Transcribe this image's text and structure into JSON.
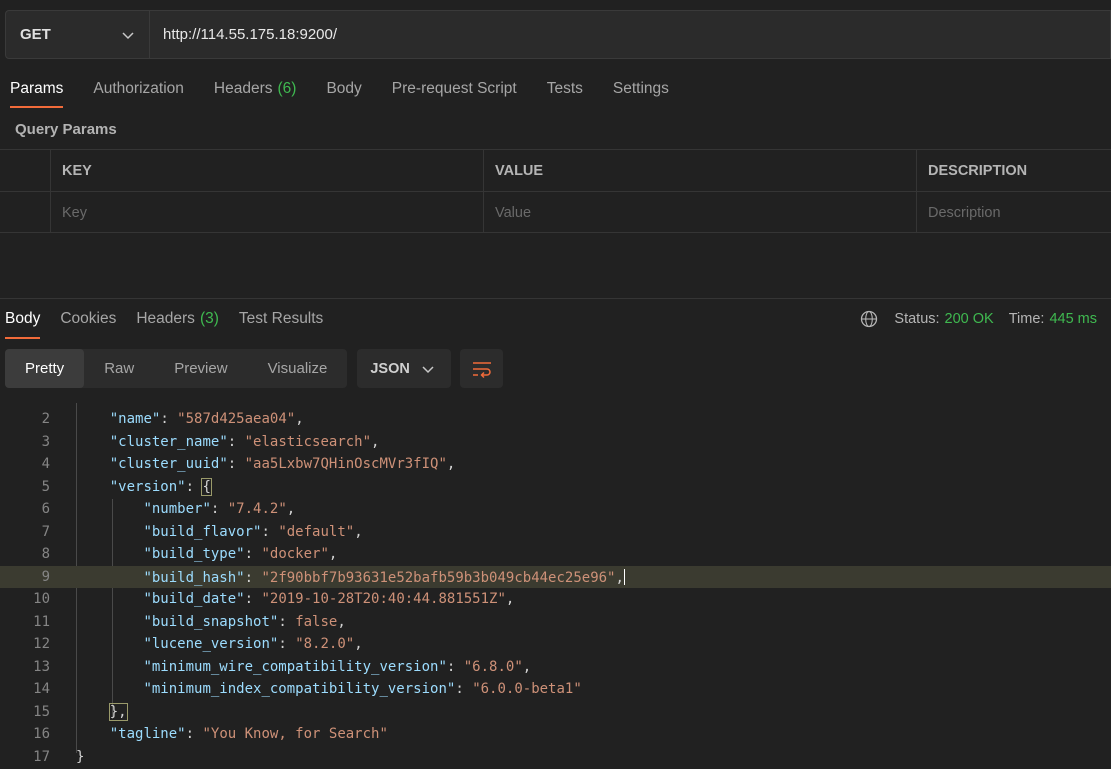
{
  "request": {
    "method": "GET",
    "url": "http://114.55.175.18:9200/"
  },
  "request_tabs": [
    {
      "label": "Params",
      "active": true
    },
    {
      "label": "Authorization"
    },
    {
      "label": "Headers",
      "count": "(6)"
    },
    {
      "label": "Body"
    },
    {
      "label": "Pre-request Script"
    },
    {
      "label": "Tests"
    },
    {
      "label": "Settings"
    }
  ],
  "query_params": {
    "title": "Query Params",
    "headers": [
      "KEY",
      "VALUE",
      "DESCRIPTION"
    ],
    "placeholders": [
      "Key",
      "Value",
      "Description"
    ]
  },
  "response_tabs": [
    {
      "label": "Body",
      "active": true
    },
    {
      "label": "Cookies"
    },
    {
      "label": "Headers",
      "count": "(3)"
    },
    {
      "label": "Test Results"
    }
  ],
  "status": {
    "status_label": "Status:",
    "status_value": "200 OK",
    "time_label": "Time:",
    "time_value": "445 ms"
  },
  "view_modes": [
    "Pretty",
    "Raw",
    "Preview",
    "Visualize"
  ],
  "format": "JSON",
  "colors": {
    "accent": "#f26b3a",
    "success": "#3fb950",
    "key": "#9cdcfe",
    "string": "#ce9178"
  },
  "icons": [
    "chevron-down-icon",
    "globe-icon",
    "wrap-lines-icon"
  ],
  "code_lines": [
    {
      "n": "2",
      "key": "name",
      "value": "\"587d425aea04\"",
      "suffix": ","
    },
    {
      "n": "3",
      "key": "cluster_name",
      "value": "\"elasticsearch\"",
      "suffix": ","
    },
    {
      "n": "4",
      "key": "cluster_uuid",
      "value": "\"aa5Lxbw7QHinOscMVr3fIQ\"",
      "suffix": ","
    },
    {
      "n": "5",
      "key": "version",
      "value": "{",
      "suffix": ""
    },
    {
      "n": "6",
      "key": "number",
      "value": "\"7.4.2\"",
      "suffix": ","
    },
    {
      "n": "7",
      "key": "build_flavor",
      "value": "\"default\"",
      "suffix": ","
    },
    {
      "n": "8",
      "key": "build_type",
      "value": "\"docker\"",
      "suffix": ","
    },
    {
      "n": "9",
      "key": "build_hash",
      "value": "\"2f90bbf7b93631e52bafb59b3b049cb44ec25e96\"",
      "suffix": ","
    },
    {
      "n": "10",
      "key": "build_date",
      "value": "\"2019-10-28T20:40:44.881551Z\"",
      "suffix": ","
    },
    {
      "n": "11",
      "key": "build_snapshot",
      "value": "false",
      "suffix": ","
    },
    {
      "n": "12",
      "key": "lucene_version",
      "value": "\"8.2.0\"",
      "suffix": ","
    },
    {
      "n": "13",
      "key": "minimum_wire_compatibility_version",
      "value": "\"6.8.0\"",
      "suffix": ","
    },
    {
      "n": "14",
      "key": "minimum_index_compatibility_version",
      "value": "\"6.0.0-beta1\"",
      "suffix": ""
    },
    {
      "n": "15",
      "text": "},"
    },
    {
      "n": "16",
      "key": "tagline",
      "value": "\"You Know, for Search\"",
      "suffix": ""
    },
    {
      "n": "17",
      "text": "}"
    }
  ]
}
